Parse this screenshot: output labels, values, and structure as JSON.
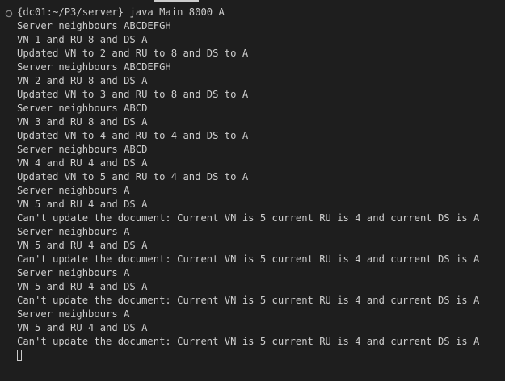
{
  "terminal": {
    "colors": {
      "background": "#1e1e1e",
      "foreground": "#cccccc"
    },
    "prompt_marker_icon": "circle-outline-icon",
    "lines": [
      "{dc01:~/P3/server} java Main 8000 A",
      "Server neighbours ABCDEFGH",
      "VN 1 and RU 8 and DS A",
      "Updated VN to 2 and RU to 8 and DS to A",
      "Server neighbours ABCDEFGH",
      "VN 2 and RU 8 and DS A",
      "Updated VN to 3 and RU to 8 and DS to A",
      "Server neighbours ABCD",
      "VN 3 and RU 8 and DS A",
      "Updated VN to 4 and RU to 4 and DS to A",
      "Server neighbours ABCD",
      "VN 4 and RU 4 and DS A",
      "Updated VN to 5 and RU to 4 and DS to A",
      "Server neighbours A",
      "VN 5 and RU 4 and DS A",
      "Can't update the document: Current VN is 5 current RU is 4 and current DS is A",
      "Server neighbours A",
      "VN 5 and RU 4 and DS A",
      "Can't update the document: Current VN is 5 current RU is 4 and current DS is A",
      "Server neighbours A",
      "VN 5 and RU 4 and DS A",
      "Can't update the document: Current VN is 5 current RU is 4 and current DS is A",
      "Server neighbours A",
      "VN 5 and RU 4 and DS A",
      "Can't update the document: Current VN is 5 current RU is 4 and current DS is A"
    ]
  }
}
